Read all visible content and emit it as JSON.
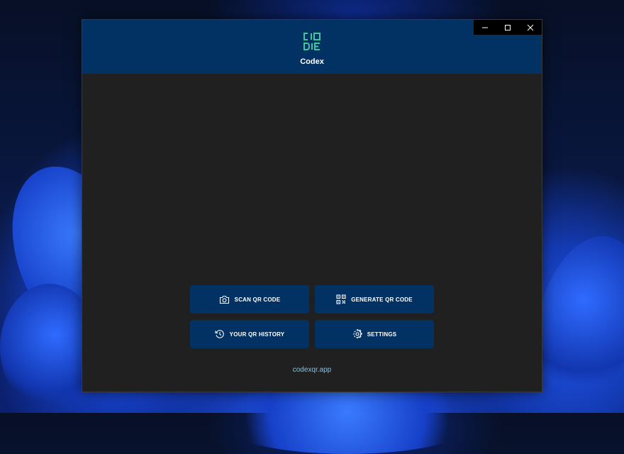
{
  "app": {
    "title": "Codex",
    "logo_text_top": "CIO",
    "logo_text_bottom": "DIE"
  },
  "window_controls": {
    "minimize": "minimize-icon",
    "maximize": "maximize-icon",
    "close": "close-icon"
  },
  "actions": {
    "scan_label": "SCAN QR CODE",
    "generate_label": "GENERATE QR CODE",
    "history_label": "YOUR QR HISTORY",
    "settings_label": "SETTINGS"
  },
  "footer": {
    "link": "codexqr.app"
  },
  "colors": {
    "header": "#023264",
    "panel": "#202020",
    "accent": "#3fc79a",
    "link": "#7fc3e8"
  }
}
